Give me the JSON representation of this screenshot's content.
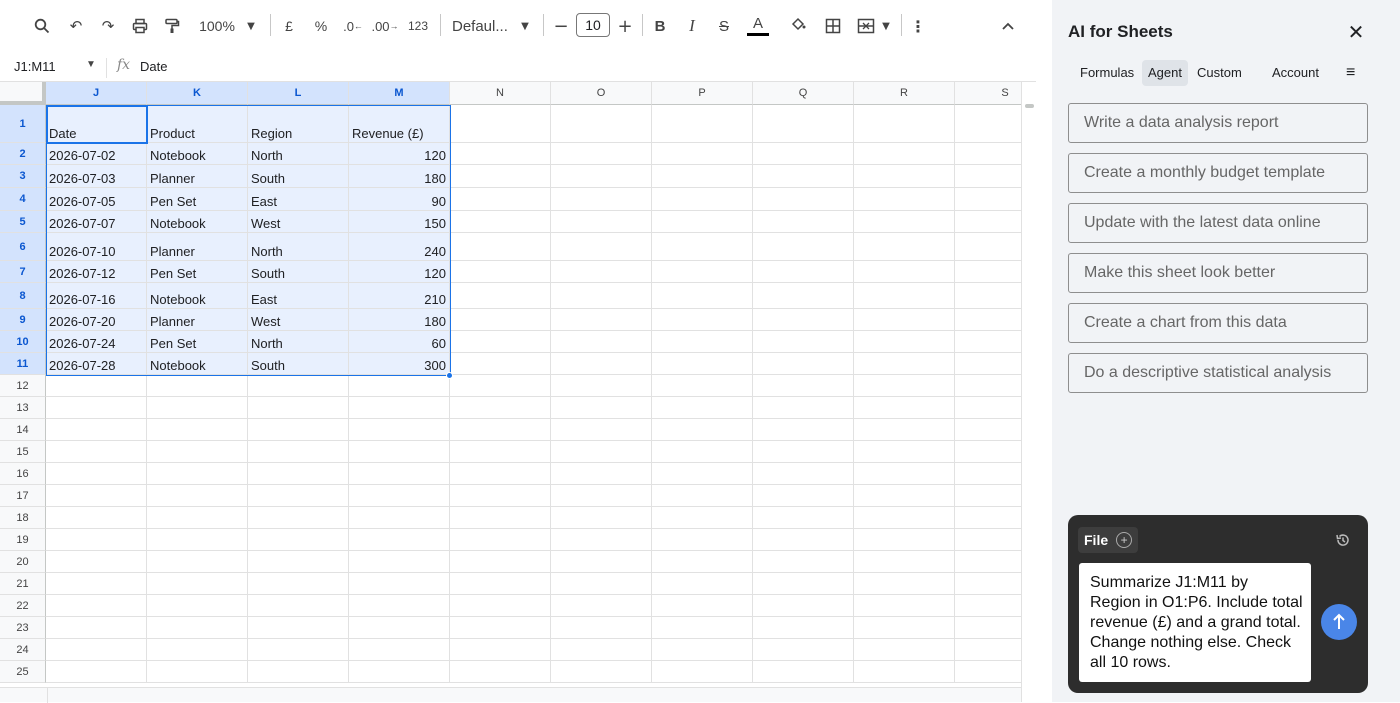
{
  "toolbar": {
    "zoom": "100%",
    "currency": "£",
    "percent": "%",
    "decrease_decimal": ".0",
    "increase_decimal": ".00",
    "number_format": "123",
    "font": "Defaul...",
    "font_size": "10"
  },
  "formula_bar": {
    "name_box": "J1:M11",
    "fx": "fx",
    "value": "Date"
  },
  "grid": {
    "columns": [
      "J",
      "K",
      "L",
      "M",
      "N",
      "O",
      "P",
      "Q",
      "R",
      "S"
    ],
    "rows": [
      "1",
      "2",
      "3",
      "4",
      "5",
      "6",
      "7",
      "8",
      "9",
      "10",
      "11",
      "12",
      "13",
      "14",
      "15",
      "16",
      "17",
      "18",
      "19",
      "20",
      "21",
      "22",
      "23",
      "24",
      "25"
    ],
    "headers": [
      "Date",
      "Product",
      "Region",
      "Revenue (£)"
    ],
    "data": [
      [
        "2026-07-02",
        "Notebook",
        "North",
        "120"
      ],
      [
        "2026-07-03",
        "Planner",
        "South",
        "180"
      ],
      [
        "2026-07-05",
        "Pen Set",
        "East",
        "90"
      ],
      [
        "2026-07-07",
        "Notebook",
        "West",
        "150"
      ],
      [
        "2026-07-10",
        "Planner",
        "North",
        "240"
      ],
      [
        "2026-07-12",
        "Pen Set",
        "South",
        "120"
      ],
      [
        "2026-07-16",
        "Notebook",
        "East",
        "210"
      ],
      [
        "2026-07-20",
        "Planner",
        "West",
        "180"
      ],
      [
        "2026-07-24",
        "Pen Set",
        "North",
        "60"
      ],
      [
        "2026-07-28",
        "Notebook",
        "South",
        "300"
      ]
    ]
  },
  "panel": {
    "title": "AI for Sheets",
    "tabs": [
      "Formulas",
      "Agent",
      "Custom",
      "Account"
    ],
    "active_tab": "Agent",
    "menu": "≡",
    "suggestions": [
      "Write a data analysis report",
      "Create a monthly budget template",
      "Update with the latest data online",
      "Make this sheet look better",
      "Create a chart from this data",
      "Do a descriptive statistical analysis"
    ],
    "file_label": "File",
    "prompt": "Summarize J1:M11 by Region in O1:P6. Include total revenue (£) and a grand total. Change nothing else. Check all 10 rows."
  }
}
